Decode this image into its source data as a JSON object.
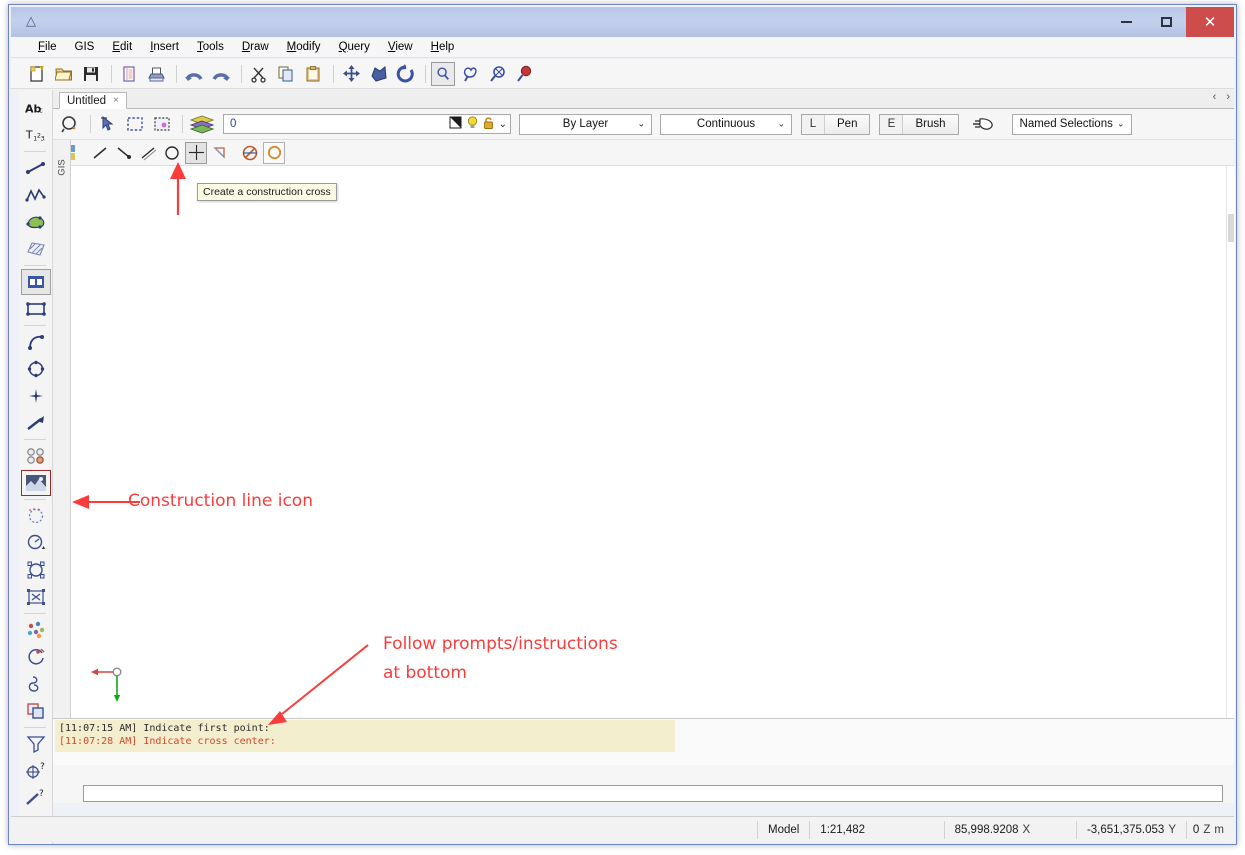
{
  "window": {
    "title": "",
    "logo_glyph": "△",
    "controls": {
      "minimize": "minimize-button",
      "maximize": "maximize-button",
      "close": "✕"
    }
  },
  "menubar": {
    "items": [
      {
        "label": "File",
        "accel": "F"
      },
      {
        "label": "GIS",
        "accel": ""
      },
      {
        "label": "Edit",
        "accel": "E"
      },
      {
        "label": "Insert",
        "accel": "I"
      },
      {
        "label": "Tools",
        "accel": "T"
      },
      {
        "label": "Draw",
        "accel": "D"
      },
      {
        "label": "Modify",
        "accel": "M"
      },
      {
        "label": "Query",
        "accel": "Q"
      },
      {
        "label": "View",
        "accel": "V"
      },
      {
        "label": "Help",
        "accel": "H"
      }
    ]
  },
  "main_toolbar": {
    "icons": [
      "new-document-icon",
      "open-folder-icon",
      "save-disk-icon",
      "print-preview-icon",
      "print-icon",
      "undo-arc-icon",
      "redo-arc-icon",
      "cut-scissors-icon",
      "copy-icon",
      "paste-clipboard-icon",
      "pan-move-icon",
      "zoom-extents-icon",
      "refresh-rotate-icon",
      "zoom-window-icon",
      "zoom-selection-icon",
      "zoom-all-icon",
      "zoom-previous-icon"
    ]
  },
  "left_toolbar": {
    "icons": [
      "text-abc-icon",
      "text-subscript-icon",
      "line-segment-icon",
      "polyline-icon",
      "polygon-fill-icon",
      "hatch-pattern-icon",
      "block-insert-icon",
      "rectangle-icon",
      "arc-icon",
      "circle-polygon-icon",
      "point-icon",
      "arrow-leader-icon",
      "symbol-group-icon",
      "raster-image-icon",
      "select-dashed-icon",
      "measure-clock-icon",
      "node-edit-icon",
      "grip-edit-icon",
      "multi-point-icon",
      "trim-edit-icon",
      "offset-curve-icon",
      "overlap-shapes-icon",
      "filter-funnel-icon",
      "query-target-icon",
      "query-line-icon",
      "query-point-icon"
    ]
  },
  "tabstrip": {
    "tabs": [
      {
        "label": "Untitled",
        "close_glyph": "×",
        "active": true
      }
    ],
    "nav_prev": "‹",
    "nav_next": "›"
  },
  "property_toolbar": {
    "icons_left": [
      "layer-state-icon",
      "select-cursor-icon",
      "select-window-icon",
      "select-filter-icon",
      "layers-stack-icon"
    ],
    "layer_field": {
      "value": "0",
      "name": "current-layer-field"
    },
    "layer_badges": [
      "layer-print-icon",
      "layer-visible-bulb-icon",
      "layer-unlock-icon"
    ],
    "layer_dropdown_glyph": "⌄",
    "color_combo": {
      "value": "By Layer",
      "caret": "⌄"
    },
    "linetype_combo": {
      "value": "Continuous",
      "caret": "⌄"
    },
    "pen_button": {
      "key": "L",
      "label": "Pen"
    },
    "brush_button": {
      "key": "E",
      "label": "Brush"
    },
    "pointer_icon": "hand-pointer-icon",
    "named_selections": {
      "value": "Named Selections",
      "caret": "⌄"
    }
  },
  "construction_toolbar": {
    "palette_icon": "color-palette-icon",
    "tools": [
      {
        "name": "construction-line-icon",
        "state": "normal"
      },
      {
        "name": "construction-ray-icon",
        "state": "normal"
      },
      {
        "name": "construction-parallel-icon",
        "state": "normal"
      },
      {
        "name": "construction-circle-icon",
        "state": "normal"
      },
      {
        "name": "construction-cross-icon",
        "state": "selected"
      },
      {
        "name": "construction-point-icon",
        "state": "normal"
      },
      {
        "name": "delete-construction-icon",
        "state": "normal"
      },
      {
        "name": "construction-ring-icon",
        "state": "framed"
      }
    ]
  },
  "gis_dock": {
    "label": "GIS"
  },
  "canvas": {
    "origin_marker": {
      "x_axis_color": "#d94040",
      "y_axis_color": "#14a814",
      "name": "origin-axis-marker"
    }
  },
  "tooltip": {
    "text": "Create a construction cross"
  },
  "annotations": {
    "color": "#fa3c3c",
    "items": [
      {
        "name": "annotation-construction-line",
        "text": "Construction line icon"
      },
      {
        "name": "annotation-follow-prompts-1",
        "text": "Follow prompts/instructions"
      },
      {
        "name": "annotation-follow-prompts-2",
        "text": "at bottom"
      }
    ]
  },
  "command_log": {
    "lines": [
      {
        "time": "[11:07:15 AM]",
        "text": "Indicate first point:",
        "style": "dark"
      },
      {
        "time": "[11:07:28 AM]",
        "text": "Indicate cross center:",
        "style": "red"
      }
    ]
  },
  "command_input": {
    "value": "",
    "placeholder": ""
  },
  "statusbar": {
    "space": "Model",
    "scale": "1:21,482",
    "x_value": "85,998.9208",
    "x_label": "X",
    "y_value": "-3,651,375.053",
    "y_label": "Y",
    "z_value": "0",
    "z_label": "Z",
    "units": "m"
  }
}
